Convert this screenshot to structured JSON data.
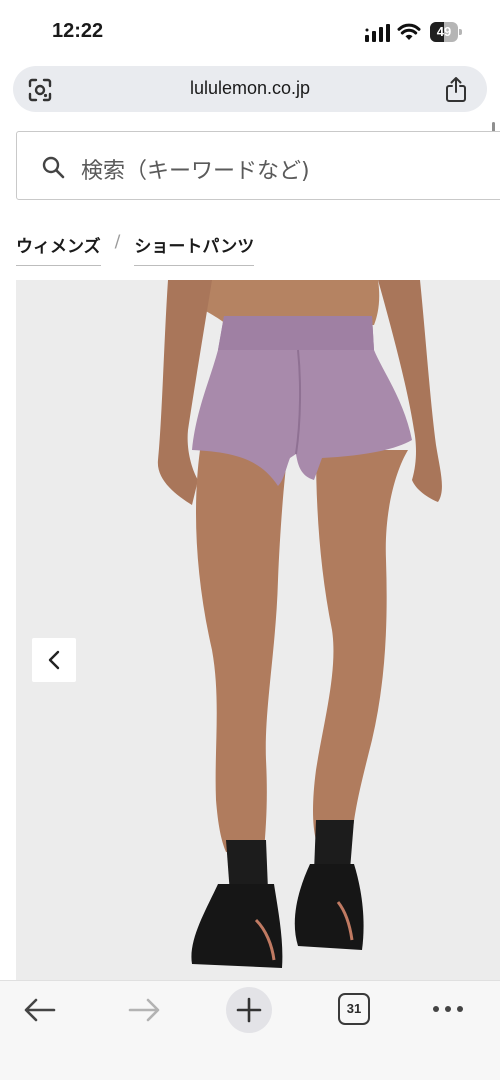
{
  "status_bar": {
    "time": "12:22",
    "battery_level": "49",
    "battery_fraction": 0.49,
    "icons": [
      "signal-icon",
      "wifi-icon",
      "battery-icon"
    ]
  },
  "browser": {
    "url": "lululemon.co.jp",
    "icons": [
      "lens-icon",
      "share-icon"
    ]
  },
  "search": {
    "placeholder": "検索（キーワードなど)",
    "icon": "search-icon"
  },
  "breadcrumb": {
    "items": [
      "ウィメンズ",
      "ショートパンツ"
    ],
    "separator": "/"
  },
  "product": {
    "image": "woman-wearing-lavender-running-shorts",
    "nav_icon": "chevron-left-icon"
  },
  "toolbar": {
    "tab_count": "31",
    "icons": [
      "back-arrow-icon",
      "forward-arrow-icon",
      "plus-icon",
      "tabs-icon",
      "more-dots-icon"
    ]
  },
  "colors": {
    "url_bar_bg": "#e9ebef",
    "shorts": "#a88aab",
    "image_bg": "#ececec"
  }
}
